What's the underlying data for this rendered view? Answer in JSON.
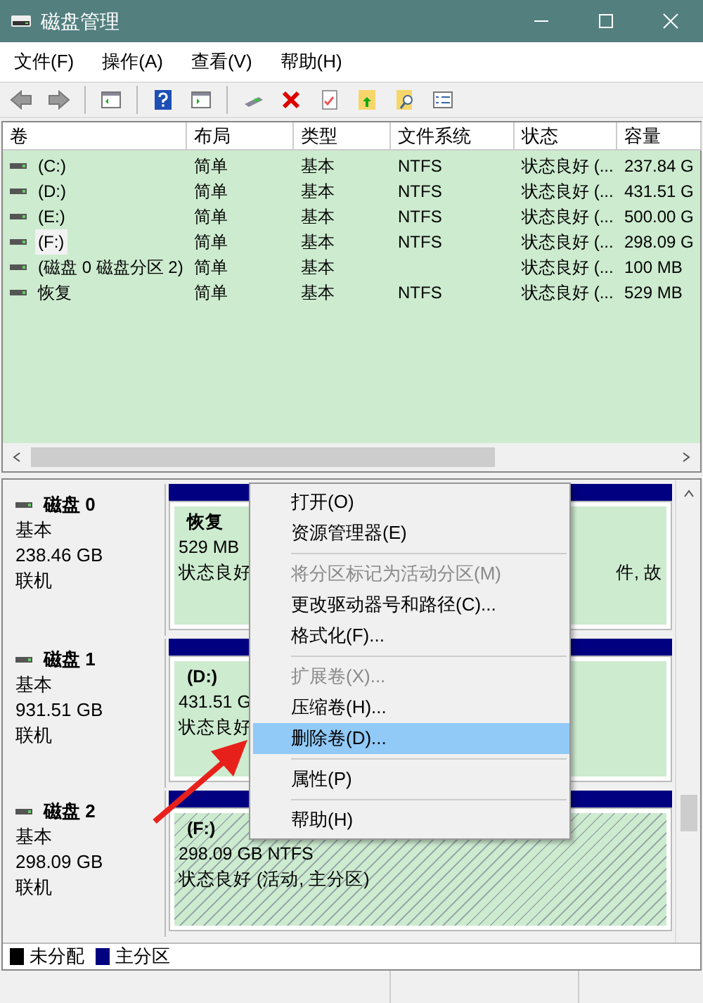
{
  "window": {
    "title": "磁盘管理"
  },
  "menu_bar": [
    "文件(F)",
    "操作(A)",
    "查看(V)",
    "帮助(H)"
  ],
  "table": {
    "columns": [
      "卷",
      "布局",
      "类型",
      "文件系统",
      "状态",
      "容量"
    ],
    "rows": [
      {
        "cells": [
          "(C:)",
          "简单",
          "基本",
          "NTFS",
          "状态良好 (...",
          "237.84 G"
        ],
        "selected": false
      },
      {
        "cells": [
          "(D:)",
          "简单",
          "基本",
          "NTFS",
          "状态良好 (...",
          "431.51 G"
        ],
        "selected": false
      },
      {
        "cells": [
          "(E:)",
          "简单",
          "基本",
          "NTFS",
          "状态良好 (...",
          "500.00 G"
        ],
        "selected": false
      },
      {
        "cells": [
          "(F:)",
          "简单",
          "基本",
          "NTFS",
          "状态良好 (...",
          "298.09 G"
        ],
        "selected": true
      },
      {
        "cells": [
          "(磁盘 0 磁盘分区 2)",
          "简单",
          "基本",
          "",
          "状态良好 (...",
          "100 MB"
        ],
        "selected": false
      },
      {
        "cells": [
          "恢复",
          "简单",
          "基本",
          "NTFS",
          "状态良好 (...",
          "529 MB"
        ],
        "selected": false
      }
    ]
  },
  "disks": [
    {
      "name": "磁盘 0",
      "type": "基本",
      "size": "238.46 GB",
      "status": "联机",
      "partitions": [
        {
          "name": "恢复",
          "size": "529 MB",
          "status": "状态良好",
          "selected": false
        },
        {
          "status": "件, 故",
          "selected": false
        }
      ]
    },
    {
      "name": "磁盘 1",
      "type": "基本",
      "size": "931.51 GB",
      "status": "联机",
      "partitions": [
        {
          "name": "(D:)",
          "size": "431.51 G",
          "status": "状态良好",
          "selected": false
        }
      ]
    },
    {
      "name": "磁盘 2",
      "type": "基本",
      "size": "298.09 GB",
      "status": "联机",
      "partitions": [
        {
          "name": "(F:)",
          "size": "298.09 GB NTFS",
          "status": "状态良好 (活动, 主分区)",
          "selected": true
        }
      ]
    }
  ],
  "legend": [
    {
      "label": "未分配",
      "color": "#000000"
    },
    {
      "label": "主分区",
      "color": "#000080"
    }
  ],
  "context_menu": [
    {
      "label": "打开(O)",
      "disabled": false,
      "selected": false,
      "separator_after": false
    },
    {
      "label": "资源管理器(E)",
      "disabled": false,
      "selected": false,
      "separator_after": true
    },
    {
      "label": "将分区标记为活动分区(M)",
      "disabled": true,
      "selected": false,
      "separator_after": false
    },
    {
      "label": "更改驱动器号和路径(C)...",
      "disabled": false,
      "selected": false,
      "separator_after": false
    },
    {
      "label": "格式化(F)...",
      "disabled": false,
      "selected": false,
      "separator_after": true
    },
    {
      "label": "扩展卷(X)...",
      "disabled": true,
      "selected": false,
      "separator_after": false
    },
    {
      "label": "压缩卷(H)...",
      "disabled": false,
      "selected": false,
      "separator_after": false
    },
    {
      "label": "删除卷(D)...",
      "disabled": false,
      "selected": true,
      "separator_after": true
    },
    {
      "label": "属性(P)",
      "disabled": false,
      "selected": false,
      "separator_after": true
    },
    {
      "label": "帮助(H)",
      "disabled": false,
      "selected": false,
      "separator_after": false
    }
  ]
}
